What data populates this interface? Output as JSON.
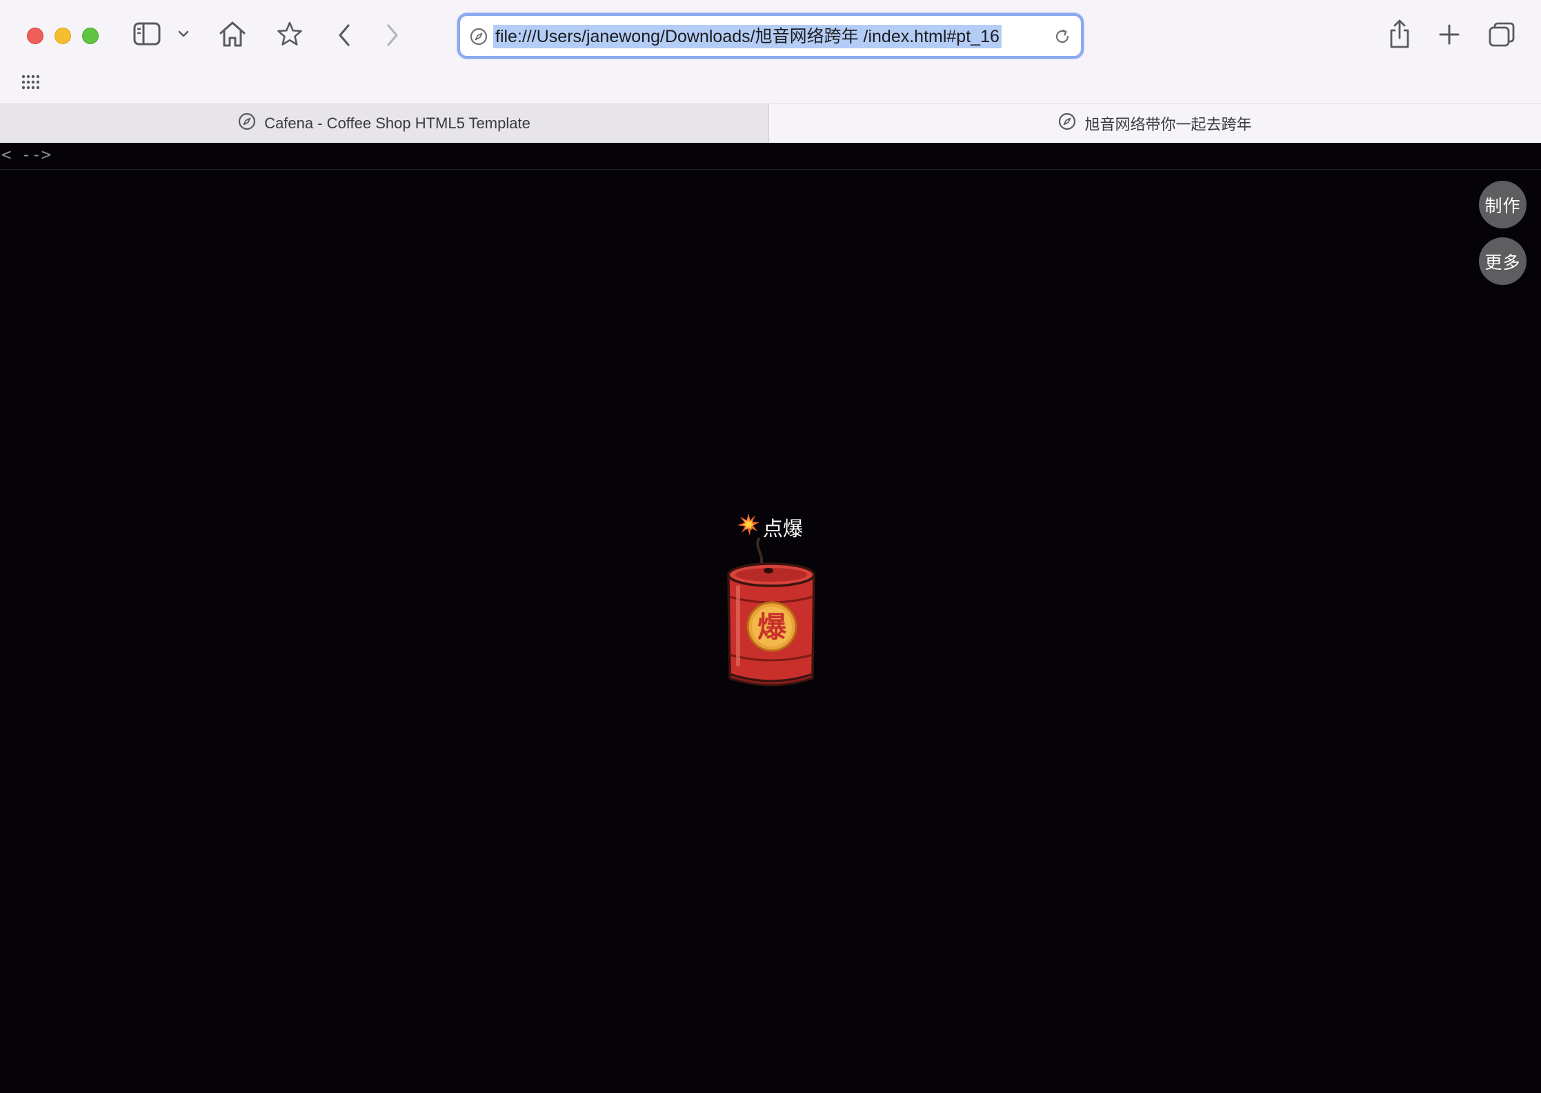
{
  "browser": {
    "url": "file:///Users/janewong/Downloads/旭音网络跨年 /index.html#pt_16",
    "tabs": [
      {
        "title": "Cafena - Coffee Shop HTML5 Template",
        "active": false
      },
      {
        "title": "旭音网络带你一起去跨年",
        "active": true
      }
    ],
    "accent_color": "#8ba8f0",
    "selection_color": "#b4cdf6"
  },
  "page": {
    "comment_text": "< -->",
    "side_buttons": {
      "make": "制作",
      "more": "更多"
    },
    "ignite_label": "点爆",
    "firecracker_char": "爆",
    "background_color": "#050307",
    "firecracker_color": "#c9302c"
  }
}
